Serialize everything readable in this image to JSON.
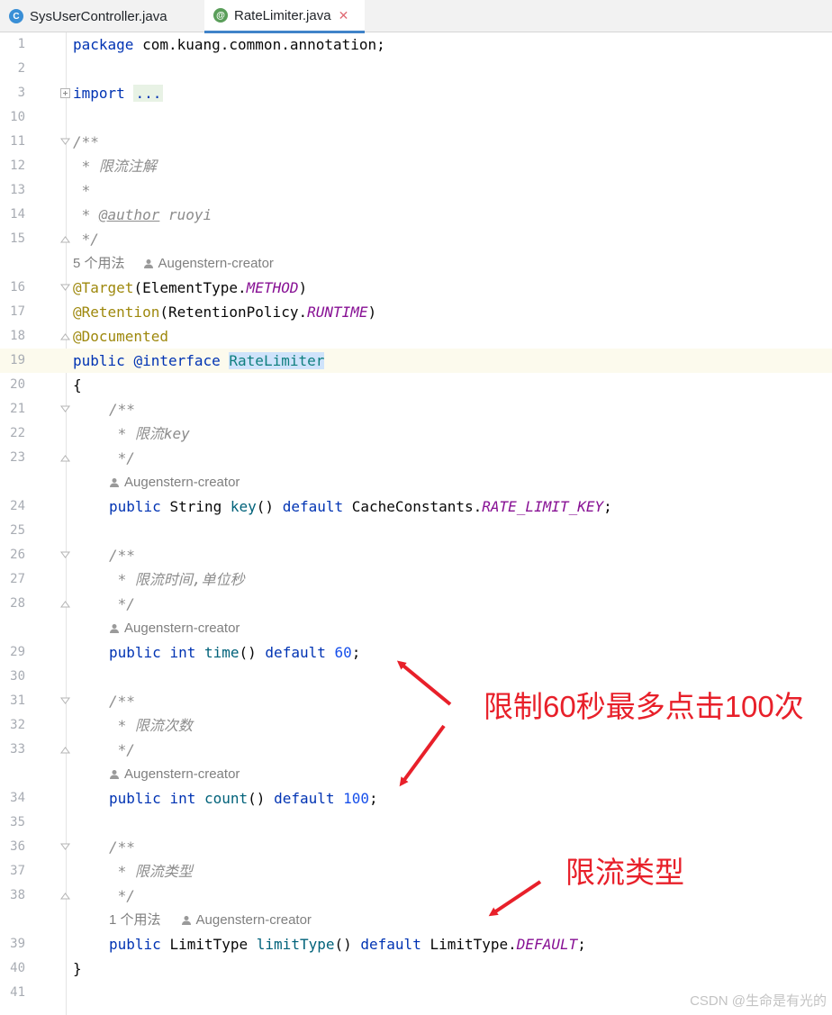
{
  "tabs": [
    {
      "label": "SysUserController.java",
      "icon": "class-icon",
      "icon_text": "C",
      "icon_color": "#3a8fd6",
      "active": false
    },
    {
      "label": "RateLimiter.java",
      "icon": "annotation-icon",
      "icon_text": "@",
      "icon_color": "#5a9e5a",
      "active": true
    }
  ],
  "code": {
    "line1": {
      "num": "1",
      "kw": "package",
      "text": " com.kuang.common.annotation;"
    },
    "line2": {
      "num": "2"
    },
    "line3": {
      "num": "3",
      "kw": "import",
      "folded": "..."
    },
    "line10": {
      "num": "10"
    },
    "line11": {
      "num": "11",
      "text": "/**"
    },
    "line12": {
      "num": "12",
      "text": " * 限流注解"
    },
    "line13": {
      "num": "13",
      "text": " *"
    },
    "line14": {
      "num": "14",
      "pre": " * ",
      "tag": "@author",
      "post": " ruoyi"
    },
    "line15": {
      "num": "15",
      "text": " */"
    },
    "hint1": {
      "usages": "5 个用法",
      "author": "Augenstern-creator"
    },
    "line16": {
      "num": "16",
      "ann": "@Target",
      "p1": "(ElementType.",
      "const": "METHOD",
      "p2": ")"
    },
    "line17": {
      "num": "17",
      "ann": "@Retention",
      "p1": "(RetentionPolicy.",
      "const": "RUNTIME",
      "p2": ")"
    },
    "line18": {
      "num": "18",
      "ann": "@Documented"
    },
    "line19": {
      "num": "19",
      "kw1": "public",
      "kw2": "@interface",
      "name": "RateLimiter"
    },
    "line20": {
      "num": "20",
      "text": "{"
    },
    "line21": {
      "num": "21",
      "text": "/**"
    },
    "line22": {
      "num": "22",
      "text": " * 限流key"
    },
    "line23": {
      "num": "23",
      "text": " */"
    },
    "hint2": {
      "author": "Augenstern-creator"
    },
    "line24": {
      "num": "24",
      "kw": "public",
      "type": "String",
      "method": "key",
      "paren": "()",
      "def": "default",
      "cls": "CacheConstants.",
      "const": "RATE_LIMIT_KEY",
      "end": ";"
    },
    "line25": {
      "num": "25"
    },
    "line26": {
      "num": "26",
      "text": "/**"
    },
    "line27": {
      "num": "27",
      "text": " * 限流时间,单位秒"
    },
    "line28": {
      "num": "28",
      "text": " */"
    },
    "hint3": {
      "author": "Augenstern-creator"
    },
    "line29": {
      "num": "29",
      "kw": "public",
      "type": "int",
      "method": "time",
      "paren": "()",
      "def": "default",
      "value": "60",
      "end": ";"
    },
    "line30": {
      "num": "30"
    },
    "line31": {
      "num": "31",
      "text": "/**"
    },
    "line32": {
      "num": "32",
      "text": " * 限流次数"
    },
    "line33": {
      "num": "33",
      "text": " */"
    },
    "hint4": {
      "author": "Augenstern-creator"
    },
    "line34": {
      "num": "34",
      "kw": "public",
      "type": "int",
      "method": "count",
      "paren": "()",
      "def": "default",
      "value": "100",
      "end": ";"
    },
    "line35": {
      "num": "35"
    },
    "line36": {
      "num": "36",
      "text": "/**"
    },
    "line37": {
      "num": "37",
      "text": " * 限流类型"
    },
    "line38": {
      "num": "38",
      "text": " */"
    },
    "hint5": {
      "usages": "1 个用法",
      "author": "Augenstern-creator"
    },
    "line39": {
      "num": "39",
      "kw": "public",
      "type": "LimitType",
      "method": "limitType",
      "paren": "()",
      "def": "default",
      "cls": "LimitType.",
      "const": "DEFAULT",
      "end": ";"
    },
    "line40": {
      "num": "40",
      "text": "}"
    },
    "line41": {
      "num": "41"
    }
  },
  "callouts": {
    "limit_note": "限制60秒最多点击100次",
    "type_note": "限流类型",
    "color": "#e8202a"
  },
  "watermark": "CSDN @生命是有光的"
}
